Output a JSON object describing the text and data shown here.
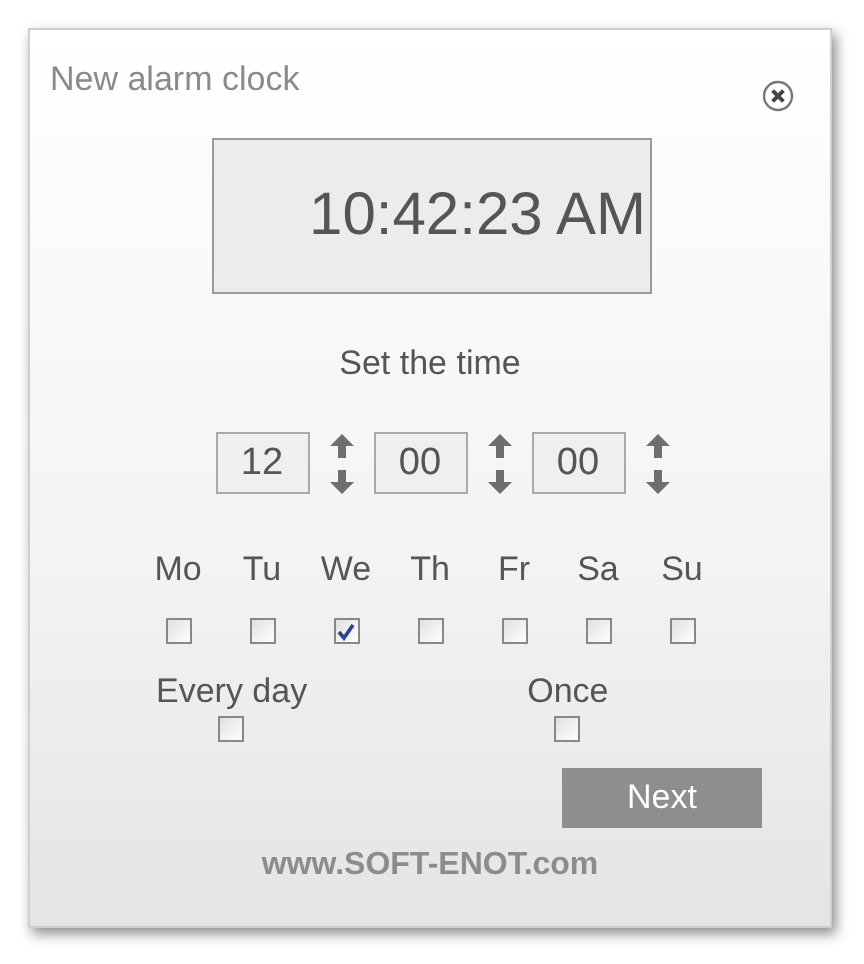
{
  "window": {
    "title": "New alarm clock"
  },
  "clock_display": "10:42:23 AM",
  "set_time_label": "Set the time",
  "time_fields": [
    "12",
    "00",
    "00"
  ],
  "days": [
    {
      "label": "Mo",
      "checked": false
    },
    {
      "label": "Tu",
      "checked": false
    },
    {
      "label": "We",
      "checked": true
    },
    {
      "label": "Th",
      "checked": false
    },
    {
      "label": "Fr",
      "checked": false
    },
    {
      "label": "Sa",
      "checked": false
    },
    {
      "label": "Su",
      "checked": false
    }
  ],
  "options": [
    {
      "label": "Every day",
      "checked": false
    },
    {
      "label": "Once",
      "checked": false
    }
  ],
  "next_button": "Next",
  "footer": "www.SOFT-ENOT.com"
}
